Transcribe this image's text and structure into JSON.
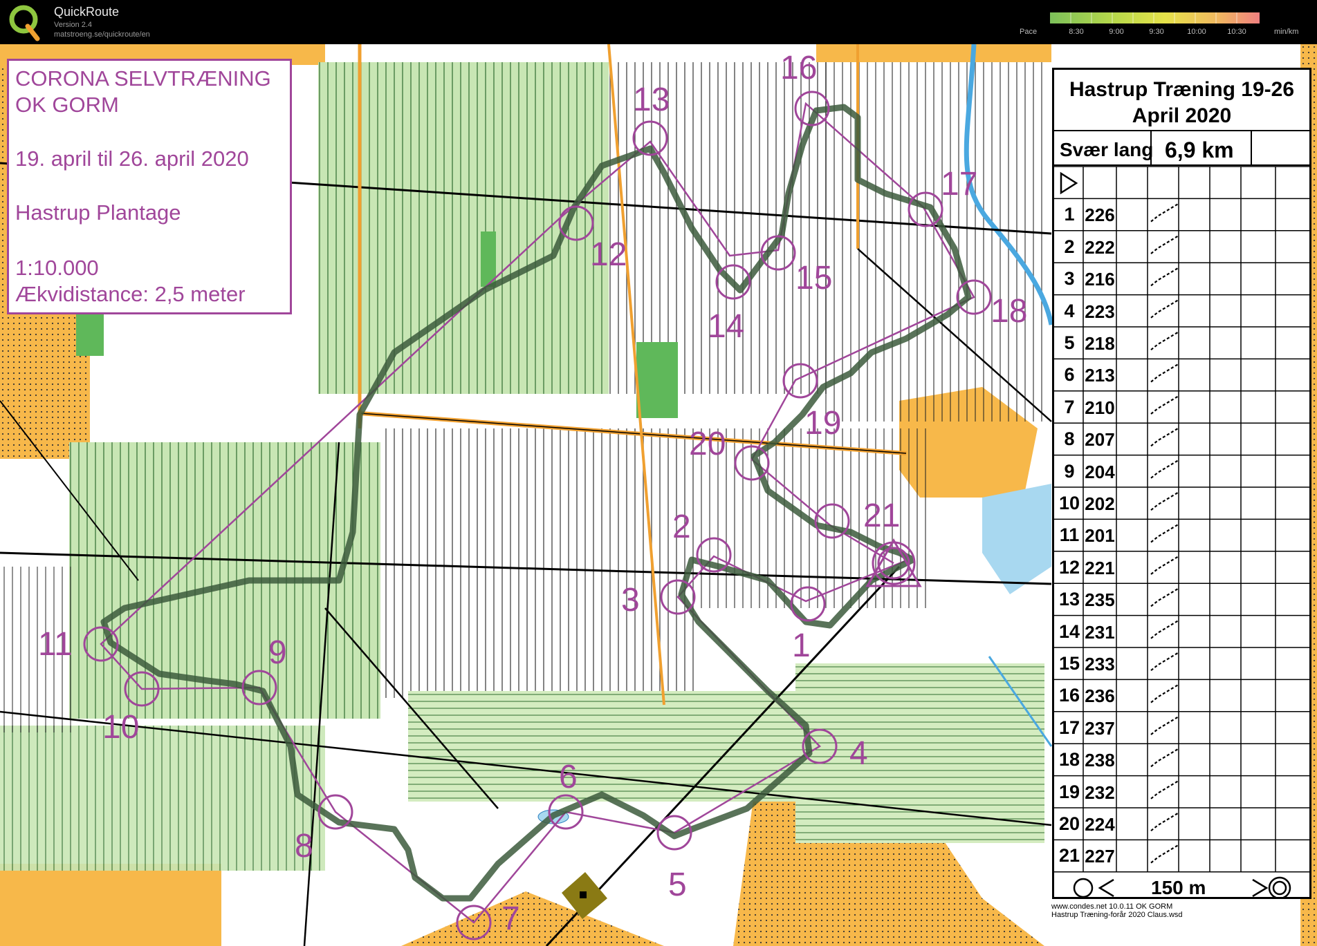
{
  "app": {
    "title": "QuickRoute",
    "version": "Version 2.4",
    "url": "matstroeng.se/quickroute/en"
  },
  "pace_scale": {
    "label": "Pace",
    "ticks": [
      "8:30",
      "9:00",
      "9:30",
      "10:00",
      "10:30"
    ],
    "unit": "min/km",
    "colors": [
      "#7cc05a",
      "#b6d84a",
      "#e6e24a",
      "#f0b860",
      "#f08080"
    ]
  },
  "info_box": {
    "line1": "CORONA SELVTRÆNING",
    "line2": "OK GORM",
    "line3": "19. april til 26. april 2020",
    "line4": "Hastrup Plantage",
    "line5": "1:10.000",
    "line6": "Ækvidistance: 2,5 meter"
  },
  "control_descriptions": {
    "title_line1": "Hastrup Træning 19-26",
    "title_line2": "April 2020",
    "course": "Svær lang",
    "length": "6,9 km",
    "rows": [
      {
        "num": "1",
        "code": "226"
      },
      {
        "num": "2",
        "code": "222"
      },
      {
        "num": "3",
        "code": "216"
      },
      {
        "num": "4",
        "code": "223"
      },
      {
        "num": "5",
        "code": "218"
      },
      {
        "num": "6",
        "code": "213"
      },
      {
        "num": "7",
        "code": "210"
      },
      {
        "num": "8",
        "code": "207"
      },
      {
        "num": "9",
        "code": "204"
      },
      {
        "num": "10",
        "code": "202"
      },
      {
        "num": "11",
        "code": "201"
      },
      {
        "num": "12",
        "code": "221"
      },
      {
        "num": "13",
        "code": "235"
      },
      {
        "num": "14",
        "code": "231"
      },
      {
        "num": "15",
        "code": "233"
      },
      {
        "num": "16",
        "code": "236"
      },
      {
        "num": "17",
        "code": "237"
      },
      {
        "num": "18",
        "code": "238"
      },
      {
        "num": "19",
        "code": "232"
      },
      {
        "num": "20",
        "code": "224"
      },
      {
        "num": "21",
        "code": "227"
      }
    ],
    "footer": "150 m"
  },
  "credits": {
    "line1": "www.condes.net 10.0.11 OK GORM",
    "line2": "Hastrup Træning-forår 2020 Claus.wsd"
  },
  "map": {
    "colors": {
      "forest": "#c8e6b4",
      "forest_dark": "#5fb85a",
      "open": "#f7b84a",
      "water": "#4aa8e0",
      "course": "#a0469a",
      "route": "#3c5a3c"
    },
    "controls": [
      {
        "label": "1"
      },
      {
        "label": "2"
      },
      {
        "label": "3"
      },
      {
        "label": "4"
      },
      {
        "label": "5"
      },
      {
        "label": "6"
      },
      {
        "label": "7"
      },
      {
        "label": "8"
      },
      {
        "label": "9"
      },
      {
        "label": "10"
      },
      {
        "label": "11"
      },
      {
        "label": "12"
      },
      {
        "label": "13"
      },
      {
        "label": "14"
      },
      {
        "label": "15"
      },
      {
        "label": "16"
      },
      {
        "label": "17"
      },
      {
        "label": "18"
      },
      {
        "label": "19"
      },
      {
        "label": "20"
      },
      {
        "label": "21"
      }
    ]
  }
}
